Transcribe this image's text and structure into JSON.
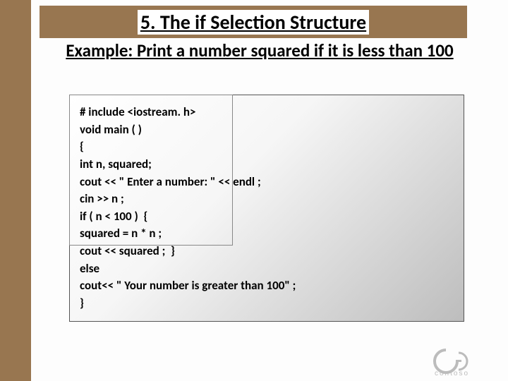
{
  "title": "5.  The if Selection Structure",
  "subtitle": "Example: Print a number squared if it is less than 100",
  "code": [
    "# include <iostream. h>",
    "void main ( )",
    "{",
    "int n, squared;",
    "cout << \" Enter a number: \" << endl ;",
    "cin >> n ;",
    "if ( n < 100 )  {",
    "squared = n * n ;",
    "cout << squared ;  }",
    "else",
    "cout<< \" Your number is greater than 100\" ;",
    "}"
  ],
  "logo_text": "contoso"
}
